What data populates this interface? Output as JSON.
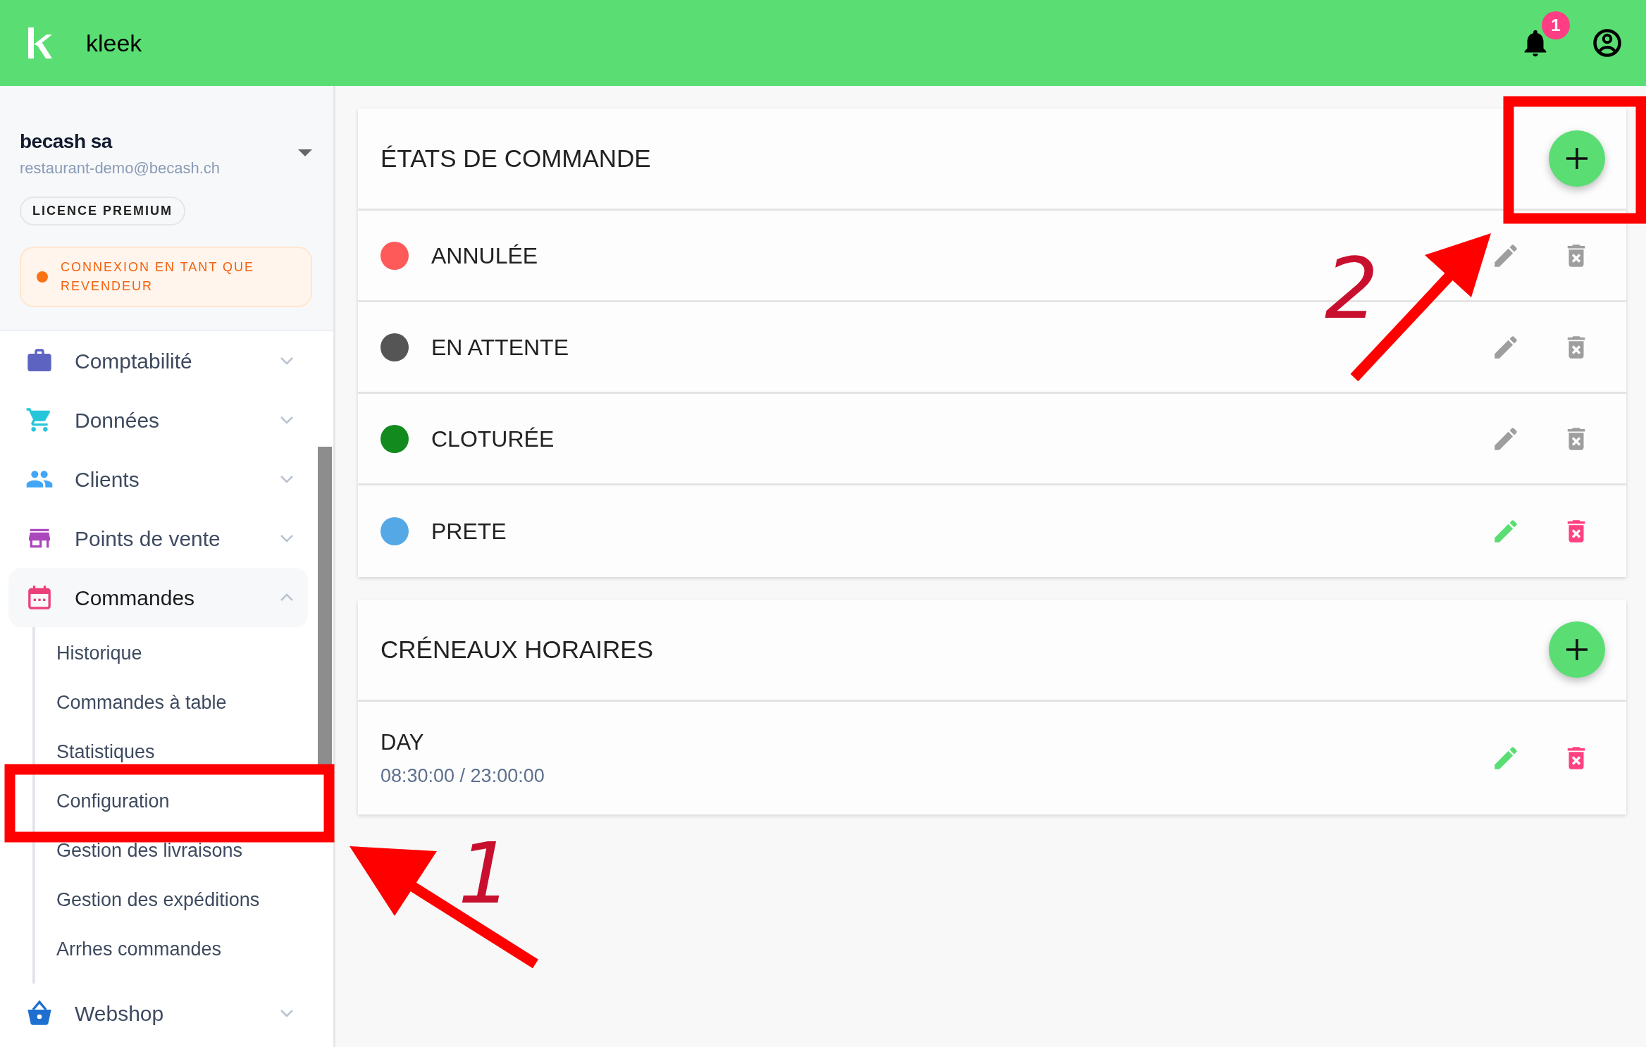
{
  "header": {
    "brand": "kleek",
    "notification_count": "1"
  },
  "account": {
    "name": "becash sa",
    "email": "restaurant-demo@becash.ch",
    "license": "LICENCE PREMIUM",
    "notice": "CONNEXION EN TANT QUE REVENDEUR"
  },
  "menu": [
    {
      "kind": "briefcase",
      "label": "Comptabilité",
      "expanded": false,
      "selected": false
    },
    {
      "kind": "cart",
      "label": "Données",
      "expanded": false,
      "selected": false
    },
    {
      "kind": "people",
      "label": "Clients",
      "expanded": false,
      "selected": false
    },
    {
      "kind": "store",
      "label": "Points de vente",
      "expanded": false,
      "selected": false
    },
    {
      "kind": "calendar",
      "label": "Commandes",
      "expanded": true,
      "selected": true,
      "children": [
        {
          "label": "Historique"
        },
        {
          "label": "Commandes à table"
        },
        {
          "label": "Statistiques"
        },
        {
          "label": "Configuration"
        },
        {
          "label": "Gestion des livraisons"
        },
        {
          "label": "Gestion des expéditions"
        },
        {
          "label": "Arrhes commandes"
        }
      ]
    },
    {
      "kind": "basket",
      "label": "Webshop",
      "expanded": false,
      "selected": false
    }
  ],
  "sections": [
    {
      "title": "ÉTATS DE COMMANDE",
      "items": [
        {
          "kind": "state",
          "label": "ANNULÉE",
          "color": "#ff5a5a",
          "editable": false
        },
        {
          "kind": "state",
          "label": "EN ATTENTE",
          "color": "#555555",
          "editable": false
        },
        {
          "kind": "state",
          "label": "CLOTURÉE",
          "color": "#128a1e",
          "editable": false
        },
        {
          "kind": "state",
          "label": "PRETE",
          "color": "#55a8e6",
          "editable": true
        }
      ]
    },
    {
      "title": "CRÉNEAUX HORAIRES",
      "items": [
        {
          "kind": "slot",
          "label": "DAY",
          "time": "08:30:00 / 23:00:00",
          "editable": true
        }
      ]
    }
  ],
  "annotations": [
    {
      "label": "1"
    },
    {
      "label": "2"
    }
  ]
}
